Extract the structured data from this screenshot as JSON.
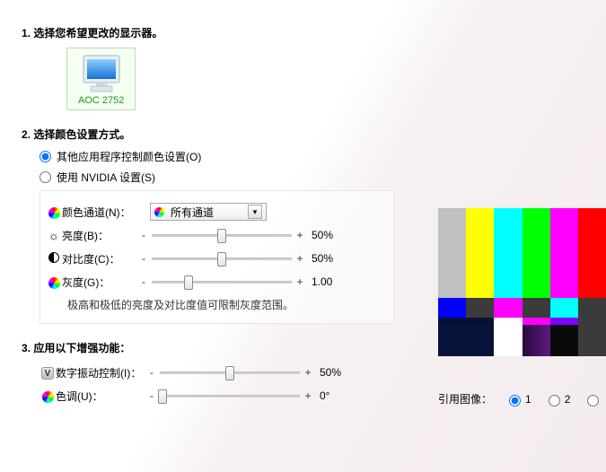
{
  "section1": {
    "title": "1.  选择您希望更改的显示器。",
    "monitor_name": "AOC 2752"
  },
  "section2": {
    "title": "2.  选择颜色设置方式。",
    "radio_other": "其他应用程序控制颜色设置(O)",
    "radio_nvidia": "使用 NVIDIA 设置(S)",
    "selected_radio": "other",
    "channel_label": "颜色通道(N)：",
    "channel_value": "所有通道",
    "brightness_label": "亮度(B)：",
    "brightness_value": "50%",
    "contrast_label": "对比度(C)：",
    "contrast_value": "50%",
    "gamma_label": "灰度(G)：",
    "gamma_value": "1.00",
    "note": "极高和极低的亮度及对比度值可限制灰度范围。"
  },
  "section3": {
    "title": "3.  应用以下增强功能：",
    "dvc_label": "数字振动控制(I)：",
    "dvc_value": "50%",
    "hue_label": "色调(U)：",
    "hue_value": "0°"
  },
  "preview": {
    "ref_label": "引用图像：",
    "opt1": "1",
    "opt2": "2",
    "selected": "1"
  },
  "glyphs": {
    "minus": "-",
    "plus": "+"
  }
}
